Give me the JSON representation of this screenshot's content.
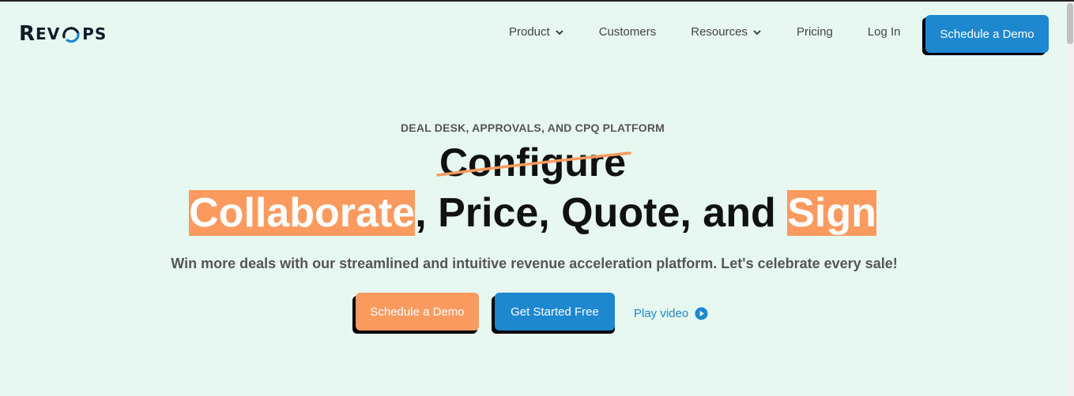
{
  "logo": {
    "part1": "Rev",
    "part2": "ps"
  },
  "nav": {
    "product": "Product",
    "customers": "Customers",
    "resources": "Resources",
    "pricing": "Pricing",
    "login": "Log In",
    "cta": "Schedule a Demo"
  },
  "hero": {
    "eyebrow": "DEAL DESK, APPROVALS, AND CPQ PLATFORM",
    "struck_word": "Configure",
    "headline": {
      "word1": "Collaborate",
      "middle": ", Price, Quote, and ",
      "word2": "Sign"
    },
    "subtitle": "Win more deals with our streamlined and intuitive revenue acceleration platform. Let's celebrate every sale!",
    "primary_cta": "Schedule a Demo",
    "secondary_cta": "Get Started Free",
    "video_link": "Play video"
  },
  "colors": {
    "background": "#e6f8ef",
    "blue": "#1d87cf",
    "orange": "#fb9a5f",
    "text_dark": "#111111",
    "text_muted": "#555555"
  },
  "icons": [
    "chevron-down-icon",
    "play-circle-icon",
    "logo-o-icon"
  ]
}
